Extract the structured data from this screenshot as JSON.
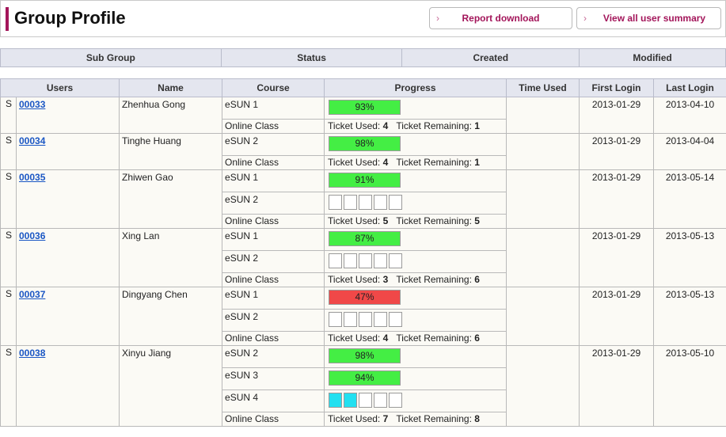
{
  "header": {
    "title": "Group Profile",
    "report_button": "Report download",
    "summary_button": "View all user summary",
    "accent_color": "#a3155a"
  },
  "group_columns": [
    "Sub Group",
    "Status",
    "Created",
    "Modified"
  ],
  "table_columns": [
    "Users",
    "Name",
    "Course",
    "Progress",
    "Time Used",
    "First Login",
    "Last Login"
  ],
  "ticket_labels": {
    "used": "Ticket Used:",
    "remaining": "Ticket Remaining:"
  },
  "users": [
    {
      "marker": "S",
      "id": "00033",
      "name": "Zhenhua Gong",
      "first_login": "2013-01-29",
      "last_login": "2013-04-10",
      "courses": [
        {
          "course": "eSUN 1",
          "progress": "93%",
          "color": "green"
        }
      ],
      "online": {
        "course": "Online Class",
        "used": "4",
        "remaining": "1"
      }
    },
    {
      "marker": "S",
      "id": "00034",
      "name": "Tinghe Huang",
      "first_login": "2013-01-29",
      "last_login": "2013-04-04",
      "courses": [
        {
          "course": "eSUN 2",
          "progress": "98%",
          "color": "green"
        }
      ],
      "online": {
        "course": "Online Class",
        "used": "4",
        "remaining": "1"
      }
    },
    {
      "marker": "S",
      "id": "00035",
      "name": "Zhiwen Gao",
      "first_login": "2013-01-29",
      "last_login": "2013-05-14",
      "courses": [
        {
          "course": "eSUN 1",
          "progress": "91%",
          "color": "green"
        },
        {
          "course": "eSUN 2",
          "boxes": 5,
          "filled": 0
        }
      ],
      "online": {
        "course": "Online Class",
        "used": "5",
        "remaining": "5"
      }
    },
    {
      "marker": "S",
      "id": "00036",
      "name": "Xing Lan",
      "first_login": "2013-01-29",
      "last_login": "2013-05-13",
      "courses": [
        {
          "course": "eSUN 1",
          "progress": "87%",
          "color": "green"
        },
        {
          "course": "eSUN 2",
          "boxes": 5,
          "filled": 0
        }
      ],
      "online": {
        "course": "Online Class",
        "used": "3",
        "remaining": "6"
      }
    },
    {
      "marker": "S",
      "id": "00037",
      "name": "Dingyang Chen",
      "first_login": "2013-01-29",
      "last_login": "2013-05-13",
      "courses": [
        {
          "course": "eSUN 1",
          "progress": "47%",
          "color": "red"
        },
        {
          "course": "eSUN 2",
          "boxes": 5,
          "filled": 0
        }
      ],
      "online": {
        "course": "Online Class",
        "used": "4",
        "remaining": "6"
      }
    },
    {
      "marker": "S",
      "id": "00038",
      "name": "Xinyu Jiang",
      "first_login": "2013-01-29",
      "last_login": "2013-05-10",
      "courses": [
        {
          "course": "eSUN 2",
          "progress": "98%",
          "color": "green"
        },
        {
          "course": "eSUN 3",
          "progress": "94%",
          "color": "green"
        },
        {
          "course": "eSUN 4",
          "boxes": 5,
          "filled": 2
        }
      ],
      "online": {
        "course": "Online Class",
        "used": "7",
        "remaining": "8"
      }
    }
  ]
}
